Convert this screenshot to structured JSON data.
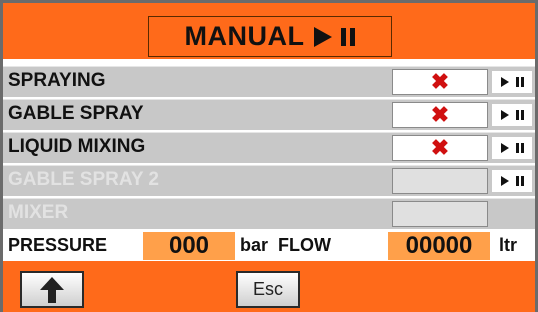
{
  "header": {
    "title": "MANUAL"
  },
  "rows": [
    {
      "label": "SPRAYING",
      "status_icon": "x-mark-icon",
      "enabled": true
    },
    {
      "label": "GABLE SPRAY",
      "status_icon": "x-mark-icon",
      "enabled": true
    },
    {
      "label": "LIQUID MIXING",
      "status_icon": "x-mark-icon",
      "enabled": true
    },
    {
      "label": "GABLE SPRAY 2",
      "status_icon": null,
      "enabled": false
    },
    {
      "label": "MIXER",
      "status_icon": null,
      "enabled": false
    }
  ],
  "metrics": {
    "pressure_label": "PRESSURE",
    "pressure_value": "000",
    "pressure_unit": "bar",
    "flow_label": "FLOW",
    "flow_value": "00000",
    "flow_unit": "ltr"
  },
  "footer": {
    "esc_label": "Esc"
  },
  "colors": {
    "accent": "#ff6a1a",
    "value_bg": "#ffa04a",
    "status_error": "#d01010"
  }
}
